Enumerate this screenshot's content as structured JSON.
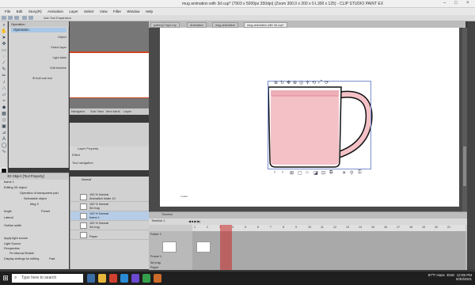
{
  "window": {
    "title": "mug animation with 3d cup* (7903 x 5000px 350dpi) (Zoom 300.0 x 200 x 0 L300 x 125) - CLIP STUDIO PAINT EX"
  },
  "menu": {
    "items": [
      "File",
      "Edit",
      "Story(R)",
      "Animation",
      "Layer",
      "Select",
      "View",
      "Filter",
      "Window",
      "Help"
    ]
  },
  "command_bar": {
    "sub_view_label": "Ask Tool Expansion"
  },
  "sub_tool": {
    "header": "Operation",
    "rows": [
      "Object",
      "Select layer",
      "Light table",
      "Edit timeline"
    ],
    "add_label": "Add sub tool",
    "selected": "Operation"
  },
  "navigator_tabs": [
    "Navigator",
    "Sub View",
    "Item bank",
    "Layer"
  ],
  "tool_property": {
    "tab": "Layer Property",
    "effect_label": "Effect",
    "nav_label": "Tool navigation"
  },
  "property_panel": {
    "header": "3D Object [Tool Property]",
    "layer_name": "frame 1",
    "rows": [
      {
        "label": "Editing 3D object",
        "value": ""
      },
      {
        "label": "",
        "value": "Operation of transparent part"
      },
      {
        "label": "",
        "value": "Selectable object"
      },
      {
        "label": "",
        "value": "Mug 3"
      },
      {
        "label": "Angle",
        "value": "Preset"
      },
      {
        "label": "Lateral",
        "value": ""
      },
      {
        "label": "Outline width",
        "value": ""
      },
      {
        "label": "Apply light source",
        "value": ""
      },
      {
        "label": "Light Source",
        "value": ""
      },
      {
        "label": "Perspective",
        "value": "Fix   Manual   Rotate"
      },
      {
        "label": "Display settings for editing",
        "value": "Fast"
      }
    ]
  },
  "layers": {
    "blend_mode": "Normal",
    "items": [
      {
        "line1": "100 % Normal",
        "line2": "Animation folder 10",
        "selected": false
      },
      {
        "line1": "100 % Normal",
        "line2": "3d mug",
        "selected": false
      },
      {
        "line1": "100 % Normal",
        "line2": "frame 1",
        "selected": true
      },
      {
        "line1": "100 % Normal",
        "line2": "3d mug",
        "selected": false
      },
      {
        "line1": "",
        "line2": "Paper",
        "selected": false
      }
    ]
  },
  "doc_tabs": [
    {
      "label": "pottery2 mp2-mp",
      "active": false
    },
    {
      "label": "Animation",
      "active": false
    },
    {
      "label": "mug animation",
      "active": false
    },
    {
      "label": "mug animation with 3d cup*",
      "active": true
    }
  ],
  "canvas": {
    "paper_color": "#ffffff",
    "mug_fill": "#f3c1c6",
    "mug_rim": "#e58f9a",
    "outline": "#111111",
    "small_text": "1 label"
  },
  "timeline": {
    "tab": "Timeline",
    "track_name": "Timeline 1",
    "frames_label": "Folder 1",
    "ruler_ticks": [
      "1",
      "2",
      "3",
      "4",
      "5",
      "6",
      "7",
      "8",
      "9",
      "10",
      "11",
      "12",
      "13",
      "14",
      "15",
      "16",
      "17",
      "18",
      "19",
      "20",
      "21"
    ],
    "current_frame": "3",
    "tracks": [
      "Folder 1",
      "Frame 1",
      "3d mug",
      "Paper"
    ]
  },
  "taskbar": {
    "search_placeholder": "Type here to search",
    "weather": "97°F  Haze",
    "lang": "ENG",
    "time": "12:05 PM",
    "date": "5/30/2021"
  }
}
